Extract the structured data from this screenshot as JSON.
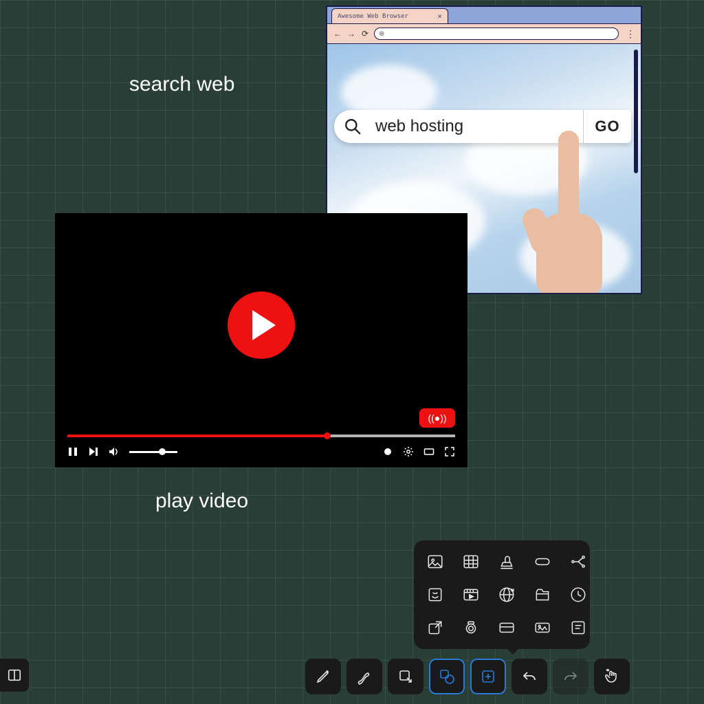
{
  "labels": {
    "search": "search web",
    "play": "play video"
  },
  "browser": {
    "tab_title": "Awesome Web Browser",
    "search_text": "web hosting",
    "go_label": "GO"
  },
  "player": {
    "progress_pct": 67,
    "live_label": "((●))"
  },
  "toolbar": {
    "items": [
      {
        "name": "pen-tool"
      },
      {
        "name": "eraser-tool"
      },
      {
        "name": "select-tool"
      },
      {
        "name": "shape-tool",
        "active": true
      },
      {
        "name": "insert-tool",
        "active": true
      },
      {
        "name": "undo"
      },
      {
        "name": "redo",
        "dim": true
      },
      {
        "name": "gesture-tool"
      }
    ]
  },
  "picker_items": [
    "image",
    "table",
    "stamp",
    "link-box",
    "connector",
    "sticky",
    "video",
    "web",
    "folder",
    "clock",
    "external",
    "camera",
    "card",
    "gallery",
    "note"
  ]
}
